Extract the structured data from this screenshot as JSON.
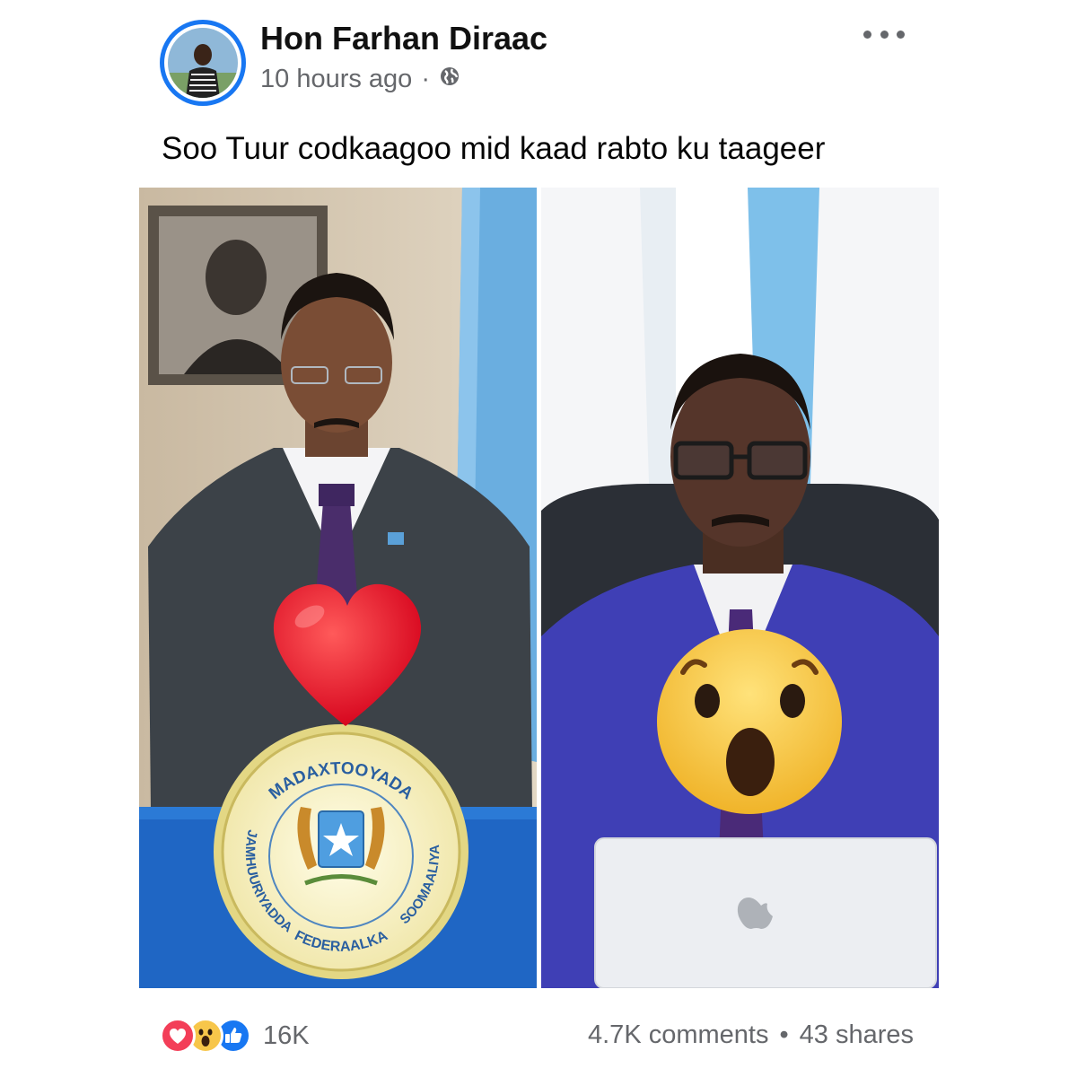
{
  "post": {
    "author": "Hon Farhan Diraac",
    "time": "10 hours ago",
    "separator": "·",
    "privacy_icon": "globe-icon",
    "caption": "Soo Tuur codkaagoo mid kaad rabto ku taageer"
  },
  "image": {
    "left_overlay": "heart-emoji",
    "right_overlay": "wow-emoji",
    "seal": {
      "top_text": "MADAXTOOYADA",
      "left_text": "JAMHUURIYADDA",
      "bottom_text": "FEDERAALKA",
      "right_text": "SOOMAALIYA"
    }
  },
  "footer": {
    "reaction_icons": [
      "love-icon",
      "wow-icon",
      "like-icon"
    ],
    "reaction_count": "16K",
    "comments": "4.7K comments",
    "dot": "•",
    "shares": "43 shares"
  },
  "colors": {
    "brand": "#1877f2",
    "text_secondary": "#65676b",
    "love": "#f33e58",
    "wow": "#f7c64a"
  }
}
